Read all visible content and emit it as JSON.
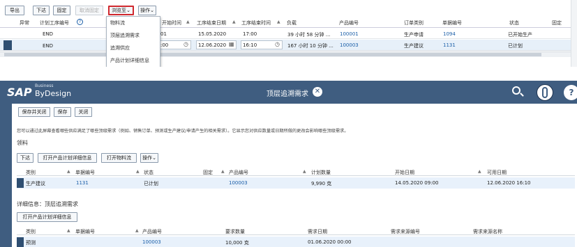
{
  "top": {
    "toolbar": {
      "export": "导出",
      "issue": "下达",
      "fix": "固定",
      "unfix": "取消固定",
      "browse": "浏览至",
      "actions": "操作"
    },
    "columns": [
      "异常",
      "计划工序编号",
      "开始时间",
      "工序结束日期",
      "工序结束时间",
      "负载",
      "产品编号",
      "订单类别",
      "单据编号",
      "状态",
      "固定"
    ],
    "rows": [
      {
        "code": "END",
        "start_time": "01",
        "end_date": "15.05.2020",
        "end_time": "17:00",
        "load": "39 小时 58 分钟 ...",
        "product": "100001",
        "order_type": "生产申请",
        "doc": "1094",
        "status": "已开始生产"
      },
      {
        "code": "END",
        "start_time": ":00",
        "end_date": "12.06.2020",
        "end_time": "16:10",
        "load": "167 小时 10 分钟 ...",
        "product": "100003",
        "order_type": "生产建议",
        "doc": "1131",
        "status": "已计划"
      }
    ],
    "menu": [
      "物料流",
      "顶层追溯需求",
      "追溯供应",
      "产品计划详细信息"
    ]
  },
  "app": {
    "brand": "SAP",
    "brand_sub": "Business",
    "brand_name": "ByDesign",
    "title": "顶层追溯需求",
    "buttons": {
      "save_close": "保存并关闭",
      "save": "保存",
      "close": "关闭"
    },
    "description": "您可以通过此屏幕查看哪些供应满足了哪些顶级需求（例如、销售订单、预测或生产建议/申请产生的相关需求）。它显示您对供应数量或日期所做的更改会影响哪些顶级需求。",
    "section_title": "领料",
    "toolbar": {
      "issue": "下达",
      "open_detail": "打开产品计划详细信息",
      "open_flow": "打开物料流",
      "actions": "操作"
    },
    "table1": {
      "headers": [
        "类别",
        "单据编号",
        "状态",
        "固定",
        "产品编号",
        "计划数量",
        "开始日期",
        "可用日期"
      ],
      "row": {
        "category": "生产建议",
        "doc": "1131",
        "status": "已计划",
        "product": "100003",
        "qty": "9,990 克",
        "start": "14.05.2020 09:00",
        "avail": "12.06.2020 16:10"
      }
    },
    "detail_title": "详细信息：顶层追溯需求",
    "detail_button": "打开产品计划详细信息",
    "table2": {
      "headers": [
        "类别",
        "单据编号",
        "产品编号",
        "要求数量",
        "需求日期",
        "需求来源编号",
        "需求来源名称"
      ],
      "row": {
        "category": "预测",
        "product": "100003",
        "qty": "10,000 克",
        "date": "01.06.2020 00:00"
      }
    }
  },
  "colors": {
    "shell": "#3f5d80",
    "accent": "#d0282e"
  }
}
